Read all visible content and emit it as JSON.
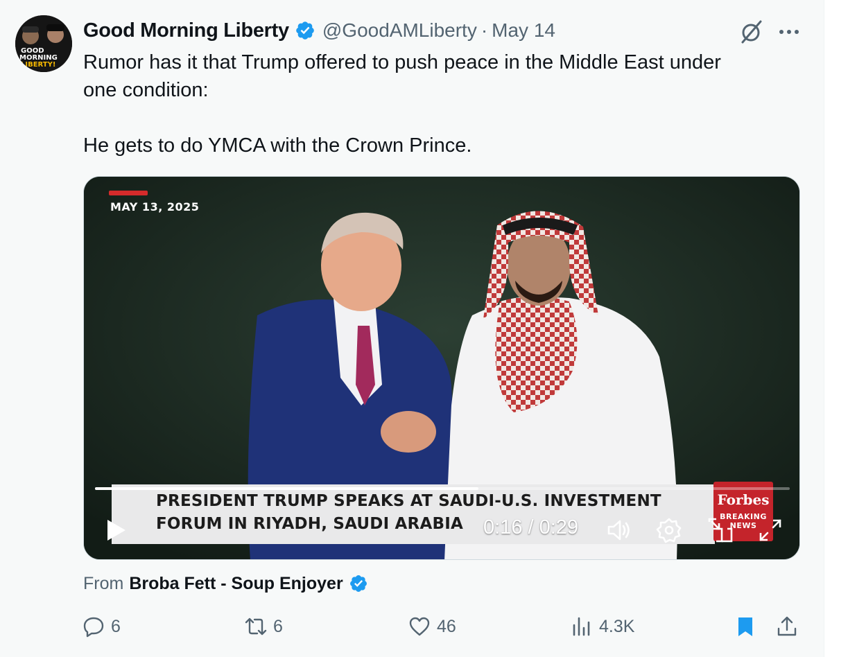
{
  "tweet": {
    "author": {
      "display_name": "Good Morning Liberty",
      "handle": "@GoodAMLiberty",
      "separator": "·",
      "date": "May 14",
      "verified": true,
      "avatar_text": [
        "GOOD",
        "MORNING",
        "LIBERTY!"
      ]
    },
    "text_lines": [
      "Rumor has it that Trump offered to push peace in the Middle East under",
      "one condition:",
      "He gets to do YMCA with the Crown Prince."
    ],
    "header_actions": {
      "grok_icon": "grok-slash-circle-icon",
      "more_icon": "more-horizontal-icon"
    }
  },
  "video": {
    "overlay_date": "MAY 13, 2025",
    "headline_line1": "PRESIDENT TRUMP SPEAKS AT SAUDI-U.S. INVESTMENT",
    "headline_line2": "FORUM IN RIYADH, SAUDI ARABIA",
    "brand": "Forbes",
    "brand_sub_line1": "BREAKING",
    "brand_sub_line2": "NEWS",
    "time_display": "0:16 / 0:29",
    "progress_fraction": 0.552,
    "controls": [
      "play-icon",
      "volume-icon",
      "settings-icon",
      "pip-icon",
      "fullscreen-icon"
    ]
  },
  "attribution": {
    "label": "From",
    "author": "Broba Fett - Soup Enjoyer",
    "verified": true
  },
  "actions": {
    "replies": "6",
    "reposts": "6",
    "likes": "46",
    "views": "4.3K"
  },
  "colors": {
    "accent_blue": "#1d9bf0",
    "text_primary": "#0f1419",
    "text_secondary": "#536471",
    "forbes_red": "#c4242b"
  }
}
